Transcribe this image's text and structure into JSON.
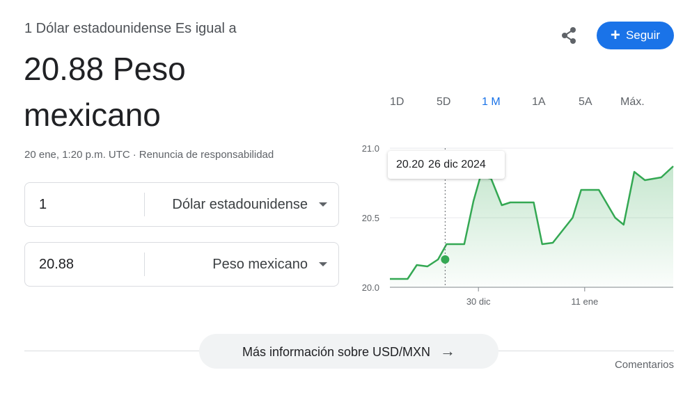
{
  "header": {
    "subtitle": "1 Dólar estadounidense Es igual a",
    "result_line1": "20.88 Peso",
    "result_line2": "mexicano",
    "timestamp": "20 ene, 1:20 p.m. UTC",
    "separator": "·",
    "disclaimer": "Renuncia de responsabilidad"
  },
  "converter": {
    "from": {
      "amount": "1",
      "unit": "Dólar estadounidense"
    },
    "to": {
      "amount": "20.88",
      "unit": "Peso mexicano"
    }
  },
  "actions": {
    "follow_label": "Seguir",
    "follow_icon": "plus-icon",
    "share_icon": "share-icon"
  },
  "ranges": [
    "1D",
    "5D",
    "1 M",
    "1A",
    "5A",
    "Máx."
  ],
  "active_range": "1 M",
  "tooltip": {
    "value": "20.20",
    "date": "26 dic 2024"
  },
  "footer": {
    "more_label": "Más información sobre USD/MXN",
    "more_icon": "arrow-right-icon",
    "feedback": "Comentarios"
  },
  "colors": {
    "accent": "#1a73e8",
    "line": "#34a853"
  },
  "chart_data": {
    "type": "area",
    "title": "",
    "xlabel": "",
    "ylabel": "",
    "ylim": [
      20.0,
      21.0
    ],
    "yticks": [
      "20.0",
      "20.5",
      "21.0"
    ],
    "xticks": [
      {
        "label": "30 dic",
        "at": 12.5
      },
      {
        "label": "11 ene",
        "at": 27.5
      }
    ],
    "grid": true,
    "series": [
      {
        "values": [
          [
            0,
            20.06
          ],
          [
            2.5,
            20.06
          ],
          [
            3.8,
            20.16
          ],
          [
            5.3,
            20.15
          ],
          [
            6.8,
            20.2
          ],
          [
            8,
            20.31
          ],
          [
            10.5,
            20.31
          ],
          [
            11.8,
            20.62
          ],
          [
            12.8,
            20.8
          ],
          [
            14.3,
            20.78
          ],
          [
            15.8,
            20.59
          ],
          [
            17,
            20.61
          ],
          [
            20.3,
            20.61
          ],
          [
            21.5,
            20.31
          ],
          [
            23,
            20.32
          ],
          [
            25.8,
            20.5
          ],
          [
            27,
            20.7
          ],
          [
            29.5,
            20.7
          ],
          [
            31.8,
            20.5
          ],
          [
            33,
            20.45
          ],
          [
            34.5,
            20.83
          ],
          [
            36,
            20.77
          ],
          [
            38.3,
            20.79
          ],
          [
            40,
            20.87
          ]
        ]
      }
    ],
    "highlight": {
      "x": 7.8,
      "y": 20.2
    }
  }
}
